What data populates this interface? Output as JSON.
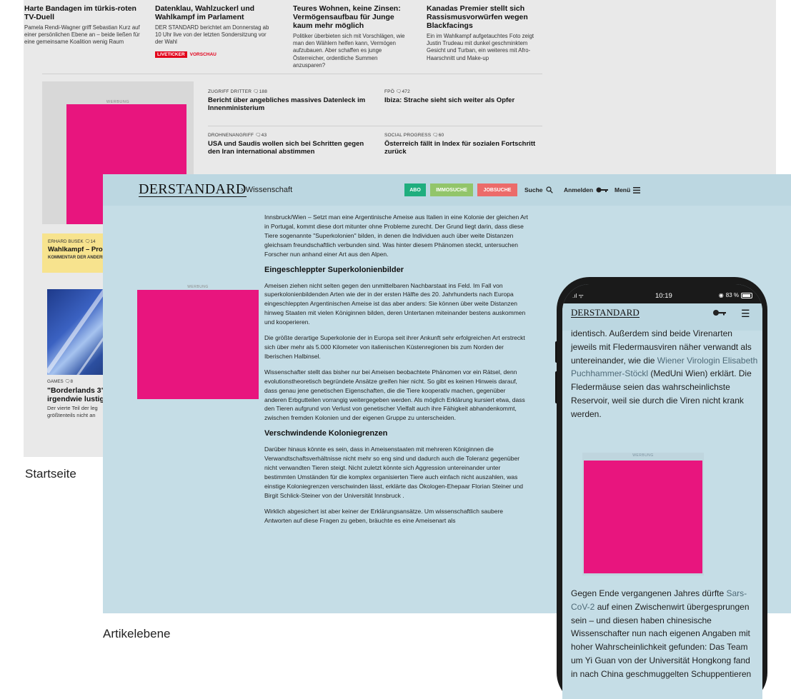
{
  "colors": {
    "ad_pink": "#e8157e",
    "abo_green": "#1fae7e",
    "immosuche_green": "#92c56a",
    "jobsuche_red": "#ec6b6a",
    "artikel_bg": "#c5dde6",
    "startseite_bg": "#e9e9e9"
  },
  "startseite": {
    "caption": "Startseite",
    "top_articles": [
      {
        "title": "Harte Bandagen im türkis-roten TV-Duell",
        "text": "Pamela Rendi-Wagner griff Sebastian Kurz auf einer persönlichen Ebene an – beide ließen für eine gemeinsame Koalition wenig Raum"
      },
      {
        "title": "Datenklau, Wahlzuckerl und Wahlkampf im Parlament",
        "text": "DER STANDARD berichtet am Donnerstag ab 10 Uhr live von der letzten Sondersitzung vor der Wahl",
        "badge_live": "LIVETICKER",
        "badge_vorschau": "VORSCHAU"
      },
      {
        "title": "Teures Wohnen, keine Zinsen: Vermögensaufbau für Junge kaum mehr möglich",
        "text": "Politiker überbieten sich mit Vorschlägen, wie man den Wählern helfen kann, Vermögen aufzubauen. Aber schaffen es junge Österreicher, ordentliche Summen anzusparen?"
      },
      {
        "title": "Kanadas Premier stellt sich Rassismusvorwürfen wegen Blackfacings",
        "text": "Ein im Wahlkampf aufgetauchtes Foto zeigt Justin Trudeau mit dunkel geschminktem Gesicht und Turban, ein weiteres mit Afro-Haarschnitt und Make-up"
      }
    ],
    "ad_label": "WERBUNG",
    "mid_articles": [
      {
        "kicker": "ZUGRIFF DRITTER",
        "comments": "188",
        "title": "Bericht über angebliches massives Datenleck im Innenministerium"
      },
      {
        "kicker": "FPÖ",
        "comments": "472",
        "title": "Ibiza: Strache sieht sich weiter als Opfer"
      },
      {
        "kicker": "DROHNENANGRIFF",
        "comments": "43",
        "title": "USA und Saudis wollen sich bei Schritten gegen den Iran international abstimmen"
      },
      {
        "kicker": "SOCIAL PROGRESS",
        "comments": "60",
        "title": "Österreich fällt in Index für sozialen Fortschritt zurück"
      }
    ],
    "busek": {
      "kicker": "ERHARD BUSEK",
      "comments": "14",
      "title": "Wahlkampf – Prob",
      "sub": "KOMMENTAR DER ANDERE"
    },
    "games": {
      "kicker": "GAMES",
      "comments": "8",
      "title_1": "\"Borderlands 3\"",
      "title_2": "irgendwie lustig",
      "text_1": "Der vierte Teil der leg",
      "text_2": "größtenteils nicht an"
    }
  },
  "artikel": {
    "caption": "Artikelebene",
    "logo": "DERSTANDARD",
    "breadcrumb": "› Wissenschaft",
    "buttons": {
      "abo": "ABO",
      "immosuche": "IMMOSUCHE",
      "jobsuche": "JOBSUCHE"
    },
    "links": {
      "suche": "Suche",
      "anmelden": "Anmelden",
      "menu": "Menü"
    },
    "ad_label": "WERBUNG",
    "paragraphs": [
      "Innsbruck/Wien – Setzt man eine Argentinische Ameise aus Italien in eine Kolonie der gleichen Art in Portugal, kommt diese dort mitunter ohne Probleme zurecht. Der Grund liegt darin, dass diese Tiere sogenannte \"Superkolonien\" bilden, in denen die Individuen auch über weite Distanzen gleichsam freundschaftlich verbunden sind. Was hinter diesem Phänomen steckt, untersuchen Forscher nun anhand einer Art aus den Alpen.",
      "Ameisen ziehen nicht selten gegen den unmittelbaren Nachbarstaat ins Feld. Im Fall von superkolonienbildenden Arten wie der in der ersten Hälfte des 20. Jahrhunderts nach Europa eingeschleppten Argentinischen Ameise ist das aber anders: Sie können über weite Distanzen hinweg Staaten mit vielen Königinnen bilden, deren Untertanen miteinander bestens auskommen und kooperieren.",
      "Die größte derartige Superkolonie der in Europa seit ihrer Ankunft sehr erfolgreichen Art erstreckt sich über mehr als 5.000 Kilometer von italienischen Küstenregionen bis zum Norden der Iberischen Halbinsel.",
      "Wissenschafter stellt das bisher nur bei Ameisen beobachtete Phänomen vor ein Rätsel, denn evolutionstheoretisch begründete Ansätze greifen hier nicht. So gibt es keinen Hinweis darauf, dass genau jene genetischen Eigenschaften, die die Tiere kooperativ machen, gegenüber anderen Erbgutteilen vorrangig weitergegeben werden. Als möglich Erklärung kursiert etwa, dass den Tieren aufgrund von Verlust von genetischer Vielfalt auch ihre Fähigkeit abhandenkommt, zwischen fremden Kolonien und der eigenen Gruppe zu unterscheiden.",
      "Darüber hinaus könnte es sein, dass in Ameisenstaaten mit mehreren Königinnen die Verwandtschaftsverhältnisse nicht mehr so eng sind und dadurch auch die Toleranz gegenüber nicht verwandten Tieren steigt. Nicht zuletzt könnte sich Aggression untereinander unter bestimmten Umständen für die komplex organisierten Tiere auch einfach nicht auszahlen, was einstige Koloniegrenzen verschwinden lässt, erklärte das Ökologen-Ehepaar Florian Steiner und Birgit Schlick-Steiner von der Universität Innsbruck .",
      "Wirklich abgesichert ist aber keiner der Erklärungsansätze. Um wissenschaftlich saubere Antworten auf diese Fragen zu geben, bräuchte es eine Ameisenart als"
    ],
    "headings": [
      "Eingeschleppter Superkolonienbilder",
      "Verschwindende Koloniegrenzen"
    ]
  },
  "phone": {
    "time": "10:19",
    "battery": "83 %",
    "logo": "DERSTANDARD",
    "text_top_1": "identisch. Außerdem sind beide Virenarten jeweils mit Fledermausviren näher verwandt als untereinander, wie die ",
    "text_top_link_1": "Wiener Virologin Elisabeth Puchhammer-Stöckl",
    "text_top_2": " (MedUni Wien) erklärt. Die Fledermäuse seien das wahrscheinlichste Reservoir, weil sie durch die Viren nicht krank werden.",
    "ad_label": "WERBUNG",
    "text_bottom_1": "Gegen Ende vergangenen Jahres dürfte ",
    "text_bottom_link": "Sars-CoV-2",
    "text_bottom_2": " auf einen Zwischenwirt übergesprungen sein – und diesen haben chinesische Wissenschafter nun nach eigenen Angaben mit hoher Wahrscheinlichkeit gefunden: Das Team um Yi Guan von der Universität Hongkong fand in nach China geschmuggelten Schuppentieren"
  }
}
